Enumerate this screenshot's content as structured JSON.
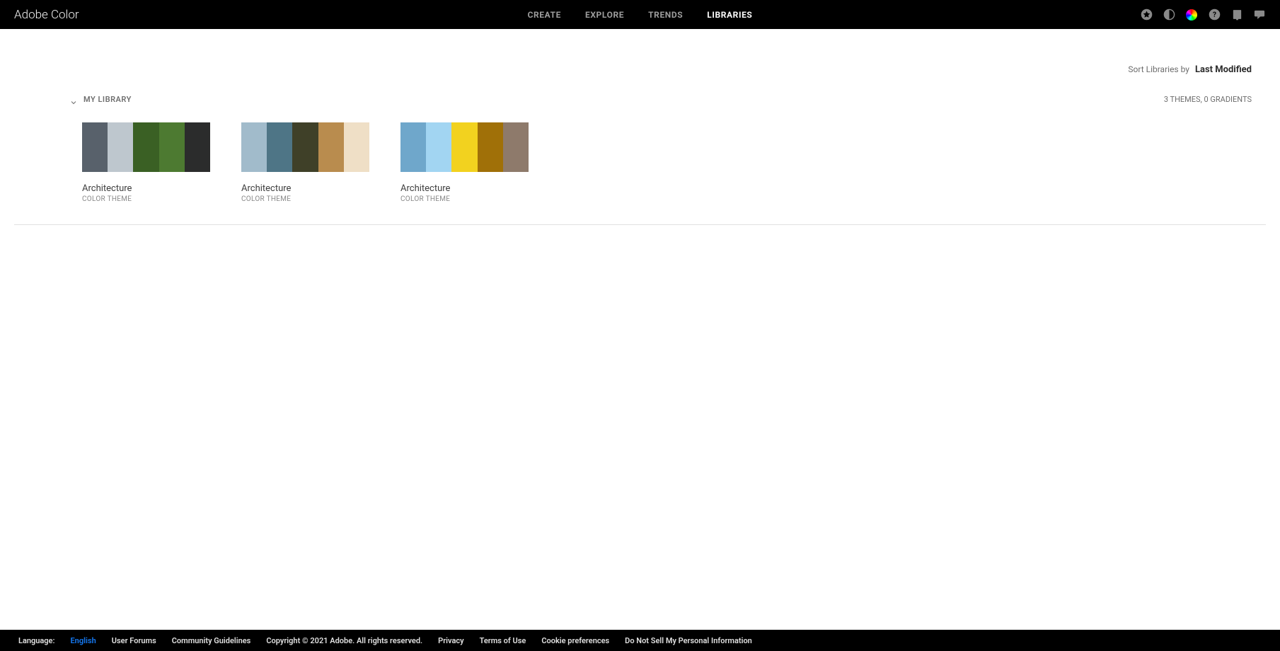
{
  "app": {
    "name": "Adobe Color"
  },
  "nav": {
    "items": [
      {
        "label": "CREATE",
        "active": false
      },
      {
        "label": "EXPLORE",
        "active": false
      },
      {
        "label": "TRENDS",
        "active": false
      },
      {
        "label": "LIBRARIES",
        "active": true
      }
    ]
  },
  "sort": {
    "label": "Sort Libraries by",
    "value": "Last Modified"
  },
  "library": {
    "name": "MY LIBRARY",
    "meta": "3 THEMES, 0 GRADIENTS",
    "themes": [
      {
        "title": "Architecture",
        "subtitle": "COLOR THEME",
        "colors": [
          "#58616B",
          "#BEC7CE",
          "#3A6024",
          "#4D7A31",
          "#2B2C2C"
        ]
      },
      {
        "title": "Architecture",
        "subtitle": "COLOR THEME",
        "colors": [
          "#A1BBCB",
          "#4E7586",
          "#3F4028",
          "#B98C4E",
          "#EFDFC6"
        ]
      },
      {
        "title": "Architecture",
        "subtitle": "COLOR THEME",
        "colors": [
          "#6FA7CB",
          "#A2D5F2",
          "#F2D21F",
          "#A07008",
          "#8E7A6B"
        ]
      }
    ]
  },
  "footer": {
    "language_label": "Language:",
    "language_value": "English",
    "links": [
      "User Forums",
      "Community Guidelines",
      "Copyright © 2021 Adobe. All rights reserved.",
      "Privacy",
      "Terms of Use",
      "Cookie preferences",
      "Do Not Sell My Personal Information"
    ]
  }
}
